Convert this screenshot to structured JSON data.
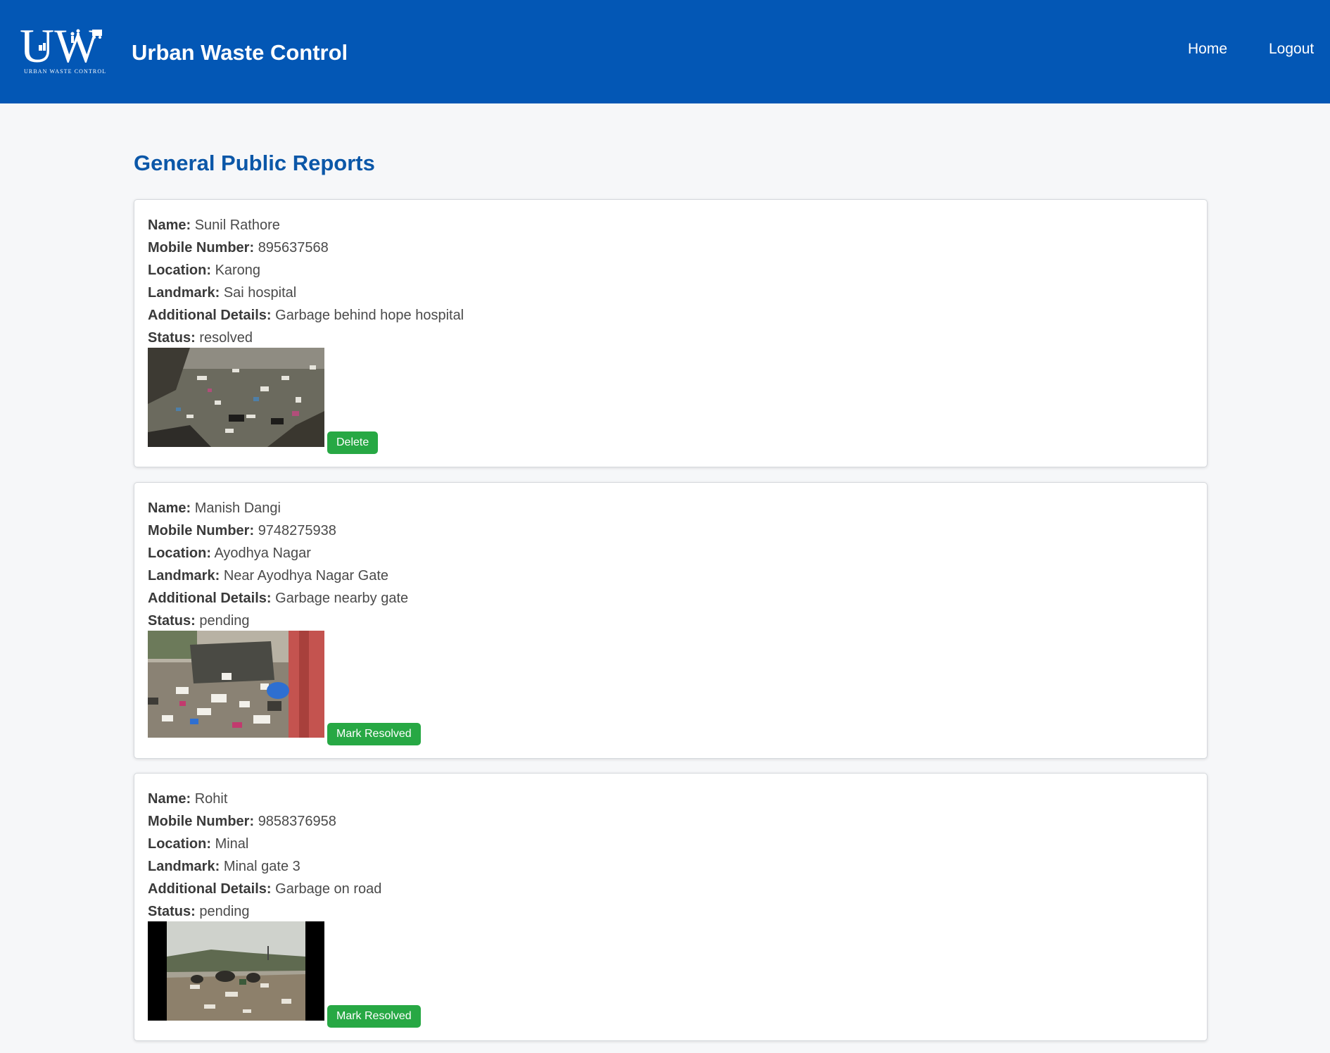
{
  "header": {
    "logo_letters": "UW",
    "logo_subtext": "URBAN WASTE CONTROL",
    "title": "Urban Waste Control",
    "nav": [
      {
        "label": "Home"
      },
      {
        "label": "Logout"
      }
    ]
  },
  "page": {
    "heading": "General Public Reports"
  },
  "field_labels": {
    "name": "Name:",
    "mobile": "Mobile Number:",
    "location": "Location:",
    "landmark": "Landmark:",
    "details": "Additional Details:",
    "status": "Status:"
  },
  "reports": [
    {
      "name": "Sunil Rathore",
      "mobile": "895637568",
      "location": "Karong",
      "landmark": "Sai hospital",
      "details": "Garbage behind hope hospital",
      "status": "resolved",
      "action_label": "Delete"
    },
    {
      "name": "Manish Dangi",
      "mobile": "9748275938",
      "location": "Ayodhya Nagar",
      "landmark": "Near Ayodhya Nagar Gate",
      "details": "Garbage nearby gate",
      "status": "pending",
      "action_label": "Mark Resolved"
    },
    {
      "name": "Rohit",
      "mobile": "9858376958",
      "location": "Minal",
      "landmark": "Minal gate 3",
      "details": "Garbage on road",
      "status": "pending",
      "action_label": "Mark Resolved"
    }
  ],
  "colors": {
    "header_bg": "#0357b5",
    "heading": "#0b57a8",
    "button": "#27a844",
    "page_bg": "#f6f7f9"
  }
}
